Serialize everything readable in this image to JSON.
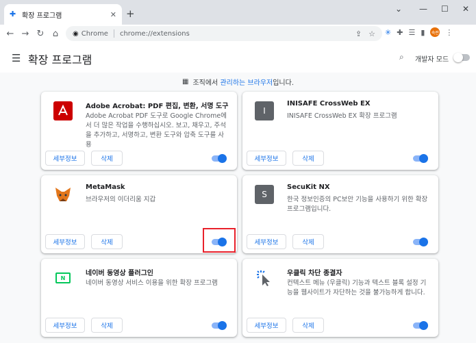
{
  "browser": {
    "tab_title": "확장 프로그램",
    "url_chip": "Chrome",
    "url": "chrome://extensions",
    "avatar_text": "숙련",
    "accent": "#1a73e8"
  },
  "header": {
    "title": "확장 프로그램",
    "dev_mode_label": "개발자 모드"
  },
  "managed": {
    "prefix": "조직에서 ",
    "link": "관리하는 브라우저",
    "suffix": "입니다."
  },
  "buttons": {
    "details": "세부정보",
    "remove": "삭제"
  },
  "extensions": [
    {
      "name": "Adobe Acrobat: PDF 편집, 변환, 서명 도구",
      "description": "Adobe Acrobat PDF 도구로 Google Chrome에서 더 많은 작업을 수행하십시오. 보고, 채우고, 주석을 추가하고, 서명하고, 변환 도구와 압축 도구를 사용",
      "icon": "adobe-acrobat-icon",
      "enabled": true
    },
    {
      "name": "INISAFE CrossWeb EX",
      "description": "INISAFE CrossWeb EX 확장 프로그램",
      "icon": "letter-i-icon",
      "icon_text": "I",
      "enabled": true
    },
    {
      "name": "MetaMask",
      "description": "브라우저의 이더리움 지갑",
      "icon": "metamask-fox-icon",
      "enabled": true
    },
    {
      "name": "SecuKit NX",
      "description": "한국 정보인증의 PC보안 기능을 사용하기 위한 확장 프로그램입니다.",
      "icon": "letter-s-icon",
      "icon_text": "S",
      "enabled": true
    },
    {
      "name": "네이버 동영상 플러그인",
      "description": "네이버 동영상 서비스 이용을 위한 확장 프로그램",
      "icon": "naver-video-icon",
      "icon_text": "N",
      "enabled": true
    },
    {
      "name": "우클릭 차단 종결자",
      "description": "컨텍스트 메뉴 (우클릭) 기능과 텍스트 블록 설정 기능을 웹사이트가 자단하는 것을 불가능하게 합니다.",
      "icon": "cursor-click-icon",
      "enabled": true
    }
  ]
}
